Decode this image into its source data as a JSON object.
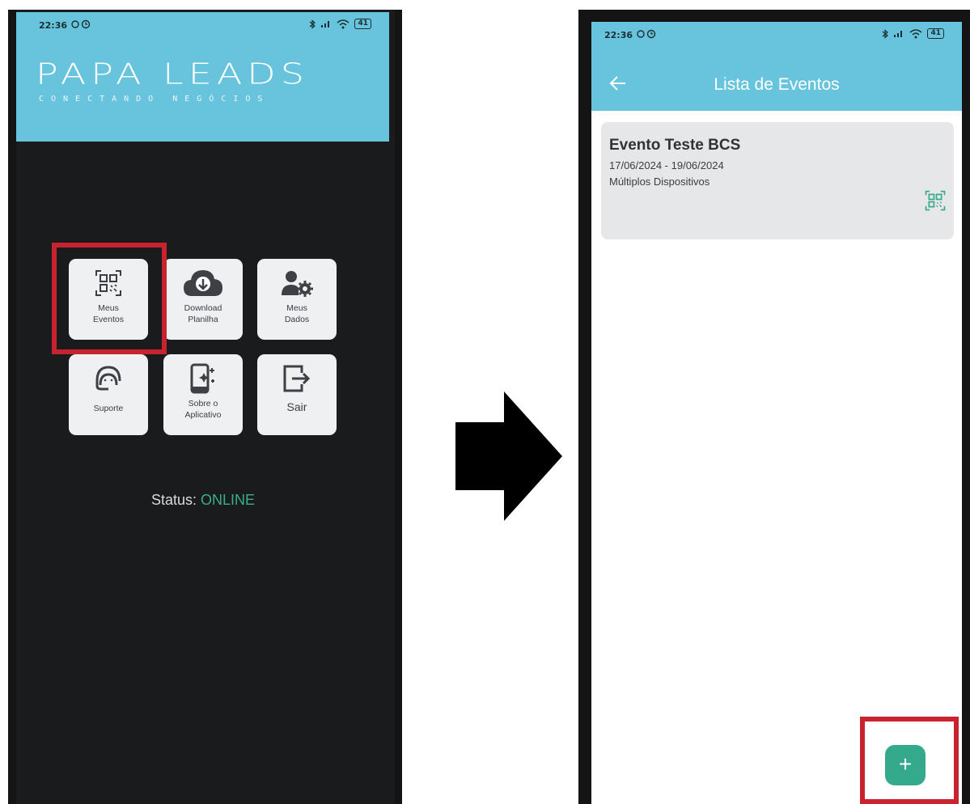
{
  "left_screen": {
    "status_time": "22:36",
    "battery": "41",
    "logo_text": "PAPA LEADS",
    "logo_tagline": "CONECTANDO NEGÓCIOS",
    "menu": [
      {
        "line1": "Meus",
        "line2": "Eventos",
        "icon": "qr-code-icon"
      },
      {
        "line1": "Download",
        "line2": "Planilha",
        "icon": "cloud-download-icon"
      },
      {
        "line1": "Meus",
        "line2": "Dados",
        "icon": "user-settings-icon"
      },
      {
        "line1": "Suporte",
        "line2": "",
        "icon": "support-headset-icon"
      },
      {
        "line1": "Sobre o",
        "line2": "Aplicativo",
        "icon": "phone-sparkle-icon"
      },
      {
        "line1": "Sair",
        "line2": "",
        "icon": "logout-icon"
      }
    ],
    "status_label": "Status:",
    "status_value": "ONLINE"
  },
  "right_screen": {
    "status_time": "22:36",
    "battery": "41",
    "title": "Lista de Eventos",
    "events": [
      {
        "name": "Evento Teste BCS",
        "dates": "17/06/2024 - 19/06/2024",
        "mode": "Múltiplos Dispositivos"
      }
    ],
    "fab_label": "+"
  },
  "colors": {
    "header": "#68c4dc",
    "dark_bg": "#1a1b1d",
    "tile_bg": "#eef0f2",
    "highlight": "#c8232e",
    "online": "#3aae8a",
    "fab": "#35a98b"
  }
}
